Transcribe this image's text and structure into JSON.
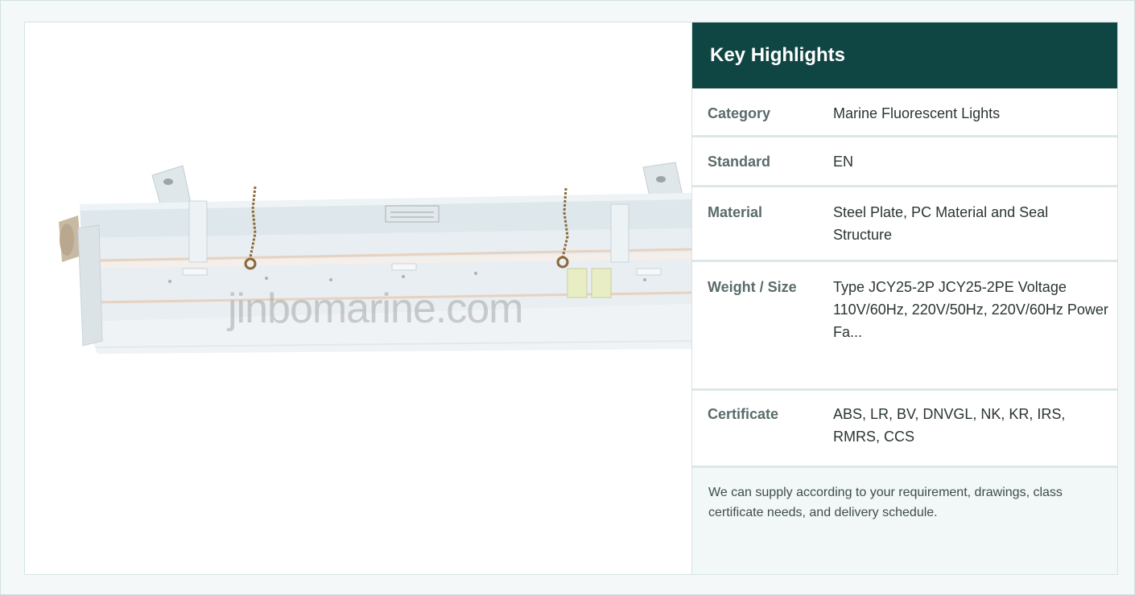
{
  "product_image": {
    "watermark": "jinbomarine.com",
    "alt": "Marine fluorescent light fixture"
  },
  "highlights": {
    "title": "Key Highlights",
    "rows": [
      {
        "label": "Category",
        "value": "Marine Fluorescent Lights"
      },
      {
        "label": "Standard",
        "value": "EN"
      },
      {
        "label": "Material",
        "value": "Steel Plate, PC Material and Seal Structure"
      },
      {
        "label": "Weight / Size",
        "value": "Type JCY25-2P JCY25-2PE Voltage 110V/60Hz, 220V/50Hz, 220V/60Hz Power Fa..."
      },
      {
        "label": "Certificate",
        "value": "ABS, LR, BV, DNVGL, NK, KR, IRS, RMRS, CCS"
      }
    ],
    "note": "We can supply according to your requirement, drawings, class certificate needs, and delivery schedule."
  },
  "colors": {
    "header_bg": "#0f4542",
    "page_bg": "#f4f8f8",
    "note_bg": "#f2f7f7"
  }
}
